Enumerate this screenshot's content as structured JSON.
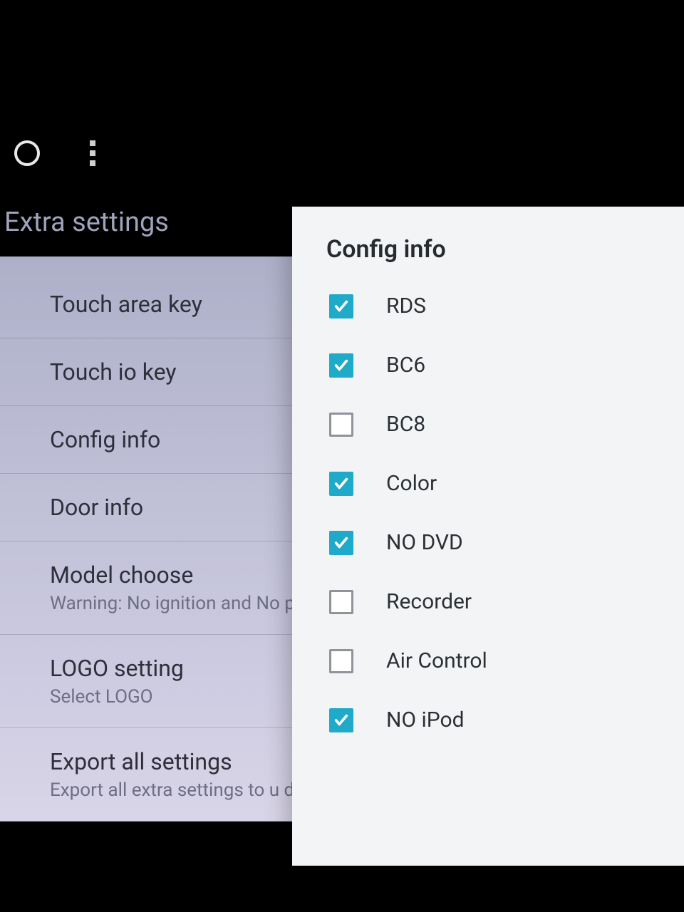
{
  "header": {
    "title": "Extra settings"
  },
  "settings": {
    "items": [
      {
        "label": "Touch area key",
        "sub": ""
      },
      {
        "label": "Touch io key",
        "sub": ""
      },
      {
        "label": "Config info",
        "sub": ""
      },
      {
        "label": "Door info",
        "sub": ""
      },
      {
        "label": "Model choose",
        "sub": "Warning: No ignition and No p"
      },
      {
        "label": "LOGO setting",
        "sub": "Select LOGO"
      },
      {
        "label": "Export all settings",
        "sub": "Export all extra settings to u d"
      }
    ]
  },
  "dialog": {
    "title": "Config info",
    "options": [
      {
        "label": "RDS",
        "checked": true
      },
      {
        "label": "BC6",
        "checked": true
      },
      {
        "label": "BC8",
        "checked": false
      },
      {
        "label": "Color",
        "checked": true
      },
      {
        "label": "NO DVD",
        "checked": true
      },
      {
        "label": "Recorder",
        "checked": false
      },
      {
        "label": "Air Control",
        "checked": false
      },
      {
        "label": "NO iPod",
        "checked": true
      }
    ]
  }
}
